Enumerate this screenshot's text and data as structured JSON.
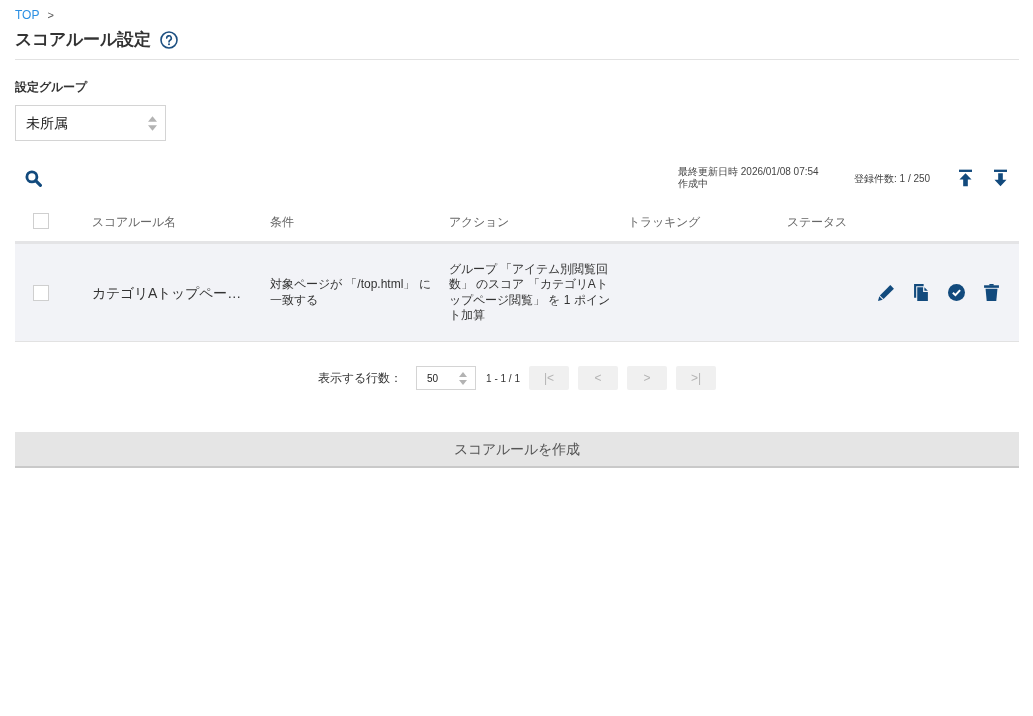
{
  "breadcrumb": [
    {
      "label": "TOP",
      "separator": ">"
    }
  ],
  "page_title": "スコアルール設定",
  "group_select": {
    "label": "設定グループ",
    "value": "未所属"
  },
  "toolbar": {
    "last_updated": "最終更新日時 2026/01/08 07:54",
    "draft_status": "作成中",
    "record_count": "登録件数: 1 / 250"
  },
  "table": {
    "select_all_checked": false,
    "columns": [
      "スコアルール名",
      "条件",
      "アクション",
      "トラッキング",
      "ステータス"
    ],
    "rows": [
      {
        "checked": false,
        "name": "カテゴリAトップペー…",
        "condition": "対象ページが 「/top.html」 に一致する",
        "action": "グループ 「アイテム別閲覧回数」 のスコア 「カテゴリAトップページ閲覧」 を 1 ポイント加算"
      }
    ]
  },
  "pagination": {
    "rows_label": "表示する行数：",
    "rows_per_page": "50",
    "range": "1 - 1 / 1",
    "buttons": [
      {
        "label": "|<",
        "disabled": true
      },
      {
        "label": "<",
        "disabled": true
      },
      {
        "label": ">",
        "disabled": true
      },
      {
        "label": ">|",
        "disabled": true
      }
    ]
  },
  "create_button": "スコアルールを作成"
}
